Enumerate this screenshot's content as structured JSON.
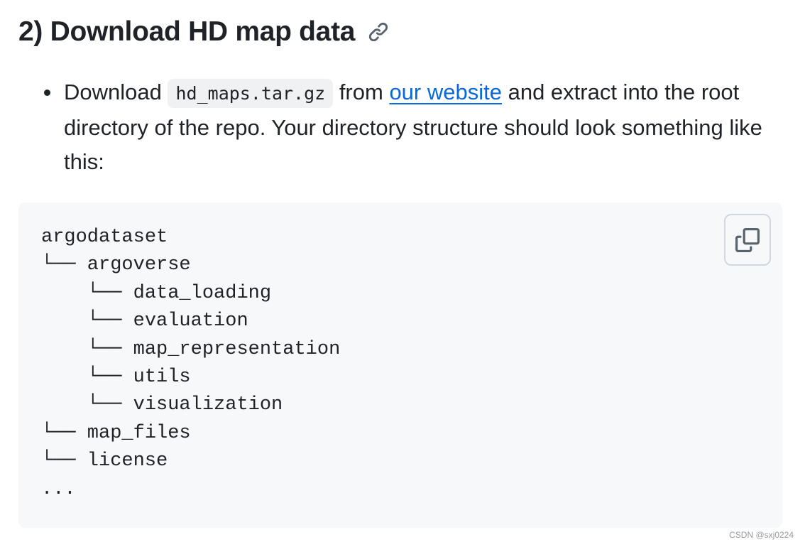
{
  "section": {
    "heading": "2) Download HD map data",
    "anchor_icon": "link-icon"
  },
  "bullet": {
    "prefix": "Download ",
    "code": "hd_maps.tar.gz",
    "middle": " from ",
    "link_text": "our website",
    "suffix": " and extract into the root directory of the repo. Your directory structure should look something like this:"
  },
  "code_block": {
    "lines": [
      "argodataset",
      "└── argoverse",
      "    └── data_loading",
      "    └── evaluation",
      "    └── map_representation",
      "    └── utils",
      "    └── visualization",
      "└── map_files",
      "└── license",
      "..."
    ],
    "copy_icon": "copy-icon"
  },
  "watermark": "CSDN @sxj0224",
  "colors": {
    "text": "#1f2328",
    "link": "#0969da",
    "code_bg": "#f6f8fa",
    "inline_code_bg": "#eff1f3",
    "border": "#d0d7de"
  }
}
